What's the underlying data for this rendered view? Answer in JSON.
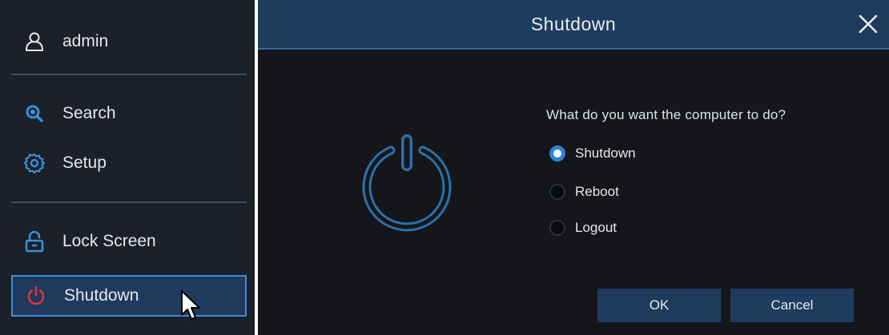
{
  "menu": {
    "user": {
      "label": "admin",
      "icon": "user-icon"
    },
    "items": [
      {
        "label": "Search",
        "icon": "search-icon",
        "icon_color": "#3a8fd8"
      },
      {
        "label": "Setup",
        "icon": "gear-icon",
        "icon_color": "#3a8fd8"
      },
      {
        "label": "Lock Screen",
        "icon": "lock-icon",
        "icon_color": "#3a8fd8"
      },
      {
        "label": "Shutdown",
        "icon": "power-icon",
        "icon_color": "#d8393a",
        "active": true
      }
    ]
  },
  "dialog": {
    "title": "Shutdown",
    "close_icon": "close-icon",
    "graphic_icon": "power-icon",
    "question": "What do you want the computer to do?",
    "options": [
      {
        "label": "Shutdown",
        "selected": true
      },
      {
        "label": "Reboot",
        "selected": false
      },
      {
        "label": "Logout",
        "selected": false
      }
    ],
    "ok_label": "OK",
    "cancel_label": "Cancel"
  },
  "colors": {
    "accent": "#2e84d4",
    "titlebar": "#1e3d5e",
    "menu_bg": "#1b2029",
    "dialog_bg": "#14161a",
    "power_red": "#d8393a"
  }
}
